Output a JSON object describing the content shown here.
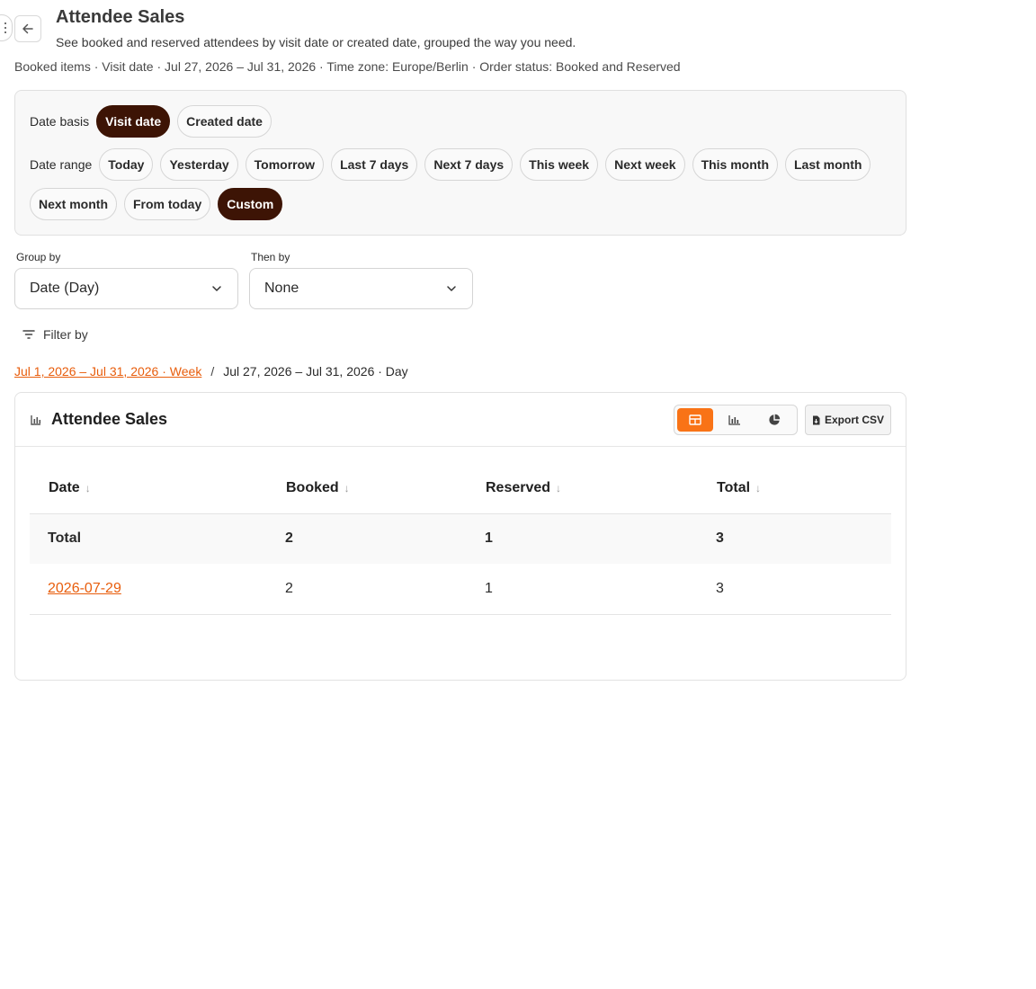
{
  "header": {
    "title": "Attendee Sales",
    "subtitle": "See booked and reserved attendees by visit date or created date, grouped the way you need.",
    "meta": "Booked items · Visit date · Jul 27, 2026 – Jul 31, 2026 · Time zone: Europe/Berlin · Order status: Booked and Reserved"
  },
  "date_basis": {
    "label": "Date basis",
    "options": [
      "Visit date",
      "Created date"
    ],
    "selected": "Visit date"
  },
  "date_range": {
    "label": "Date range",
    "options": [
      "Today",
      "Yesterday",
      "Tomorrow",
      "Last 7 days",
      "Next 7 days",
      "This week",
      "Next week",
      "This month",
      "Last month",
      "Next month",
      "From today",
      "Custom"
    ],
    "selected": "Custom"
  },
  "grouping": {
    "group_by_label": "Group by",
    "group_by_value": "Date (Day)",
    "then_by_label": "Then by",
    "then_by_value": "None"
  },
  "filter_by_label": "Filter by",
  "breadcrumb": {
    "parent": "Jul 1, 2026 – Jul 31, 2026 · Week",
    "separator": "/",
    "current": "Jul 27, 2026 – Jul 31, 2026 · Day"
  },
  "card": {
    "title": "Attendee Sales",
    "export_label": "Export CSV",
    "view_modes": [
      "table-icon",
      "bar-chart-icon",
      "pie-chart-icon"
    ],
    "active_view": "table-icon"
  },
  "table": {
    "columns": [
      "Date",
      "Booked",
      "Reserved",
      "Total"
    ],
    "sort_glyph": "↓",
    "total_row": [
      "Total",
      "2",
      "1",
      "3"
    ],
    "rows": [
      [
        "2026-07-29",
        "2",
        "1",
        "3"
      ]
    ]
  },
  "colors": {
    "accent": "#f97316",
    "link": "#e85d0c",
    "chip_active": "#3d1405"
  }
}
